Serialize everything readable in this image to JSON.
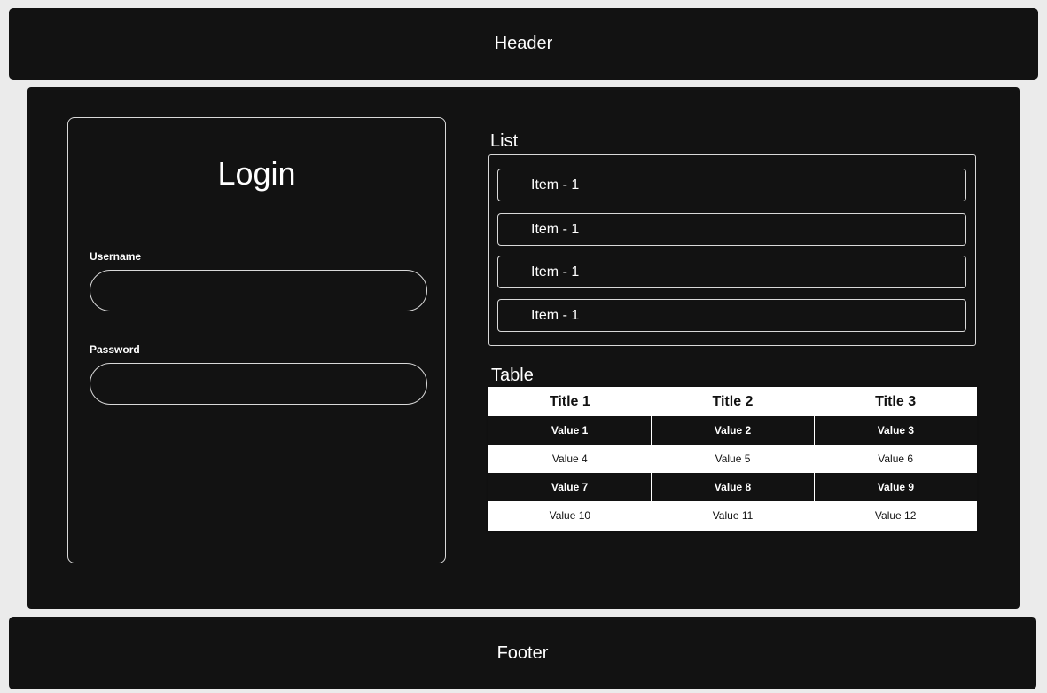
{
  "header": {
    "label": "Header"
  },
  "footer": {
    "label": "Footer"
  },
  "login": {
    "title": "Login",
    "username_label": "Username",
    "username_value": "",
    "password_label": "Password",
    "password_value": ""
  },
  "list": {
    "title": "List",
    "items": [
      {
        "label": "Item - 1"
      },
      {
        "label": "Item - 1"
      },
      {
        "label": "Item - 1"
      },
      {
        "label": "Item - 1"
      }
    ]
  },
  "table": {
    "title": "Table",
    "headers": [
      "Title 1",
      "Title 2",
      "Title 3"
    ],
    "rows": [
      [
        "Value 1",
        "Value 2",
        "Value 3"
      ],
      [
        "Value 4",
        "Value 5",
        "Value 6"
      ],
      [
        "Value 7",
        "Value 8",
        "Value 9"
      ],
      [
        "Value 10",
        "Value 11",
        "Value 12"
      ]
    ]
  }
}
